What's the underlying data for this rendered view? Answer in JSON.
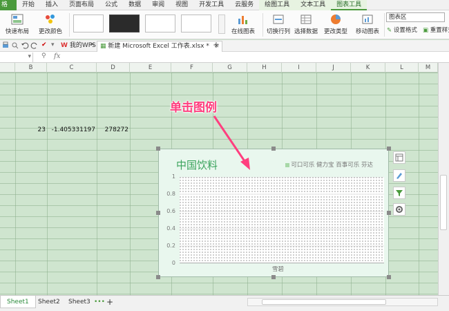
{
  "menubar": {
    "app_label": "格",
    "items": [
      "开始",
      "插入",
      "页面布局",
      "公式",
      "数据",
      "审阅",
      "视图",
      "开发工具",
      "云服务",
      "绘图工具",
      "文本工具",
      "图表工具"
    ]
  },
  "ribbon": {
    "quick_layout": "快速布局",
    "change_color": "更改颜色",
    "online_chart": "在线图表",
    "switch_row_col": "切换行列",
    "select_data": "选择数据",
    "change_type": "更改类型",
    "move_chart": "移动图表",
    "chart_area": "图表区",
    "set_format": "设置格式",
    "reset_style": "重置样式"
  },
  "tabs": {
    "my_wps": "我的WPS",
    "document": "新建 Microsoft Excel 工作表.xlsx *",
    "add": "+"
  },
  "formula": {
    "fx": "fx"
  },
  "columns": [
    "B",
    "C",
    "D",
    "E",
    "F",
    "G",
    "H",
    "I",
    "J",
    "K",
    "L",
    "M"
  ],
  "cells": {
    "b": "23",
    "c": "-1.405331197",
    "d": "278272"
  },
  "chart": {
    "title": "中国饮料",
    "legend": [
      "可口可乐",
      "健力宝",
      "百事可乐",
      "芬达"
    ],
    "yticks": [
      "1",
      "0.8",
      "0.6",
      "0.4",
      "0.2",
      "0"
    ],
    "xlabel": "雪碧"
  },
  "annotation": {
    "text": "单击图例"
  },
  "sheets": [
    "Sheet1",
    "Sheet2",
    "Sheet3"
  ],
  "sheet_more": "•••",
  "sheet_add": "+",
  "colors": {
    "accent": "#4a9a3c",
    "grid_bg": "#cfe5cf",
    "chart_bg": "#e9f7ee",
    "title_green": "#3aa35c",
    "annotation": "#ff3f7f"
  },
  "chart_data": {
    "type": "bar",
    "title": "中国饮料",
    "categories": [
      "雪碧"
    ],
    "series": [
      {
        "name": "可口可乐",
        "values": [
          0
        ]
      },
      {
        "name": "健力宝",
        "values": [
          0
        ]
      },
      {
        "name": "百事可乐",
        "values": [
          0
        ]
      },
      {
        "name": "芬达",
        "values": [
          0
        ]
      }
    ],
    "ylim": [
      0,
      1
    ],
    "yticks": [
      0,
      0.2,
      0.4,
      0.6,
      0.8,
      1
    ],
    "legend": "top-right",
    "grid": true
  }
}
